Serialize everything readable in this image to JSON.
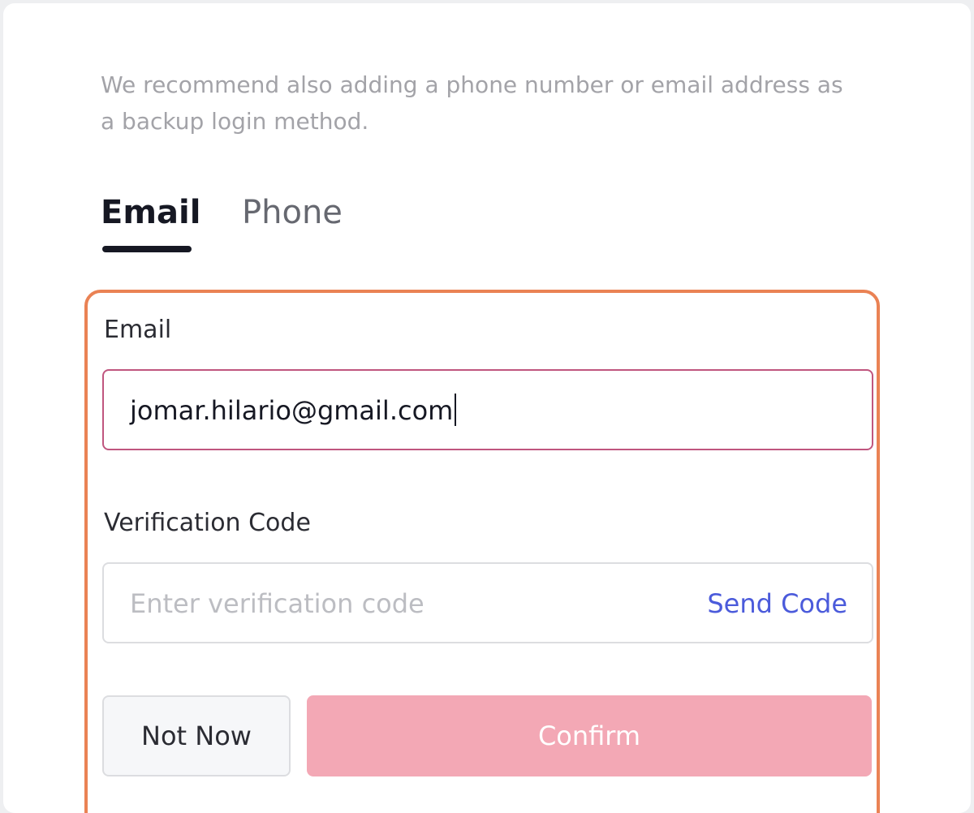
{
  "description": "We recommend also adding a phone number or email address as a backup login method.",
  "tabs": {
    "email": "Email",
    "phone": "Phone",
    "active": "Email"
  },
  "form": {
    "email_label": "Email",
    "email_value": "jomar.hilario@gmail.com",
    "code_label": "Verification Code",
    "code_placeholder": "Enter verification code",
    "send_code": "Send Code",
    "not_now": "Not Now",
    "confirm": "Confirm"
  },
  "colors": {
    "highlight_border": "#ea8254",
    "email_input_border": "#c0567f",
    "link": "#4b5bdb",
    "confirm_disabled": "#f3a8b5"
  }
}
